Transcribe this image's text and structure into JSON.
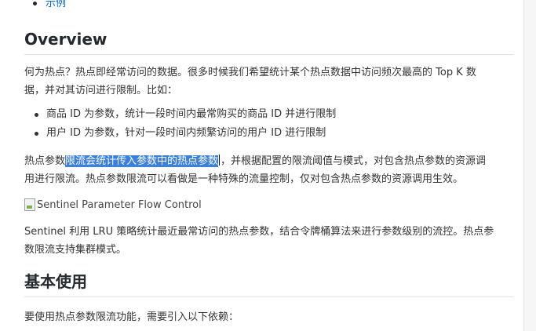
{
  "toc": {
    "item": "示例"
  },
  "overview": {
    "heading": "Overview",
    "intro_line1": "何为热点？热点即经常访问的数据。很多时候我们希望统计某个热点数据中访问频次最高的 Top K 数",
    "intro_line2": "据，并对其访问进行限制。比如：",
    "bullets": [
      "商品 ID 为参数，统计一段时间内最常购买的商品 ID 并进行限制",
      "用户 ID 为参数，针对一段时间内频繁访问的用户 ID 进行限制"
    ],
    "para2_before": "热点参数",
    "para2_highlight": "限流会统计传入参数中的热点参数",
    "para2_after": "，并根据配置的限流阈值与模式，对包含热点参数的资源调",
    "para2_line2": "用进行限流。热点参数限流可以看做是一种特殊的流量控制，仅对包含热点参数的资源调用生效。",
    "image_alt": "Sentinel Parameter Flow Control",
    "para3_line1": "Sentinel 利用 LRU 策略统计最近最常访问的热点参数，结合令牌桶算法来进行参数级别的流控。热点参",
    "para3_line2": "数限流支持集群模式。"
  },
  "basic_usage": {
    "heading": "基本使用",
    "intro": "要使用热点参数限流功能，需要引入以下依赖："
  },
  "colors": {
    "selection": "#3a80e0",
    "link": "#0366d6"
  }
}
